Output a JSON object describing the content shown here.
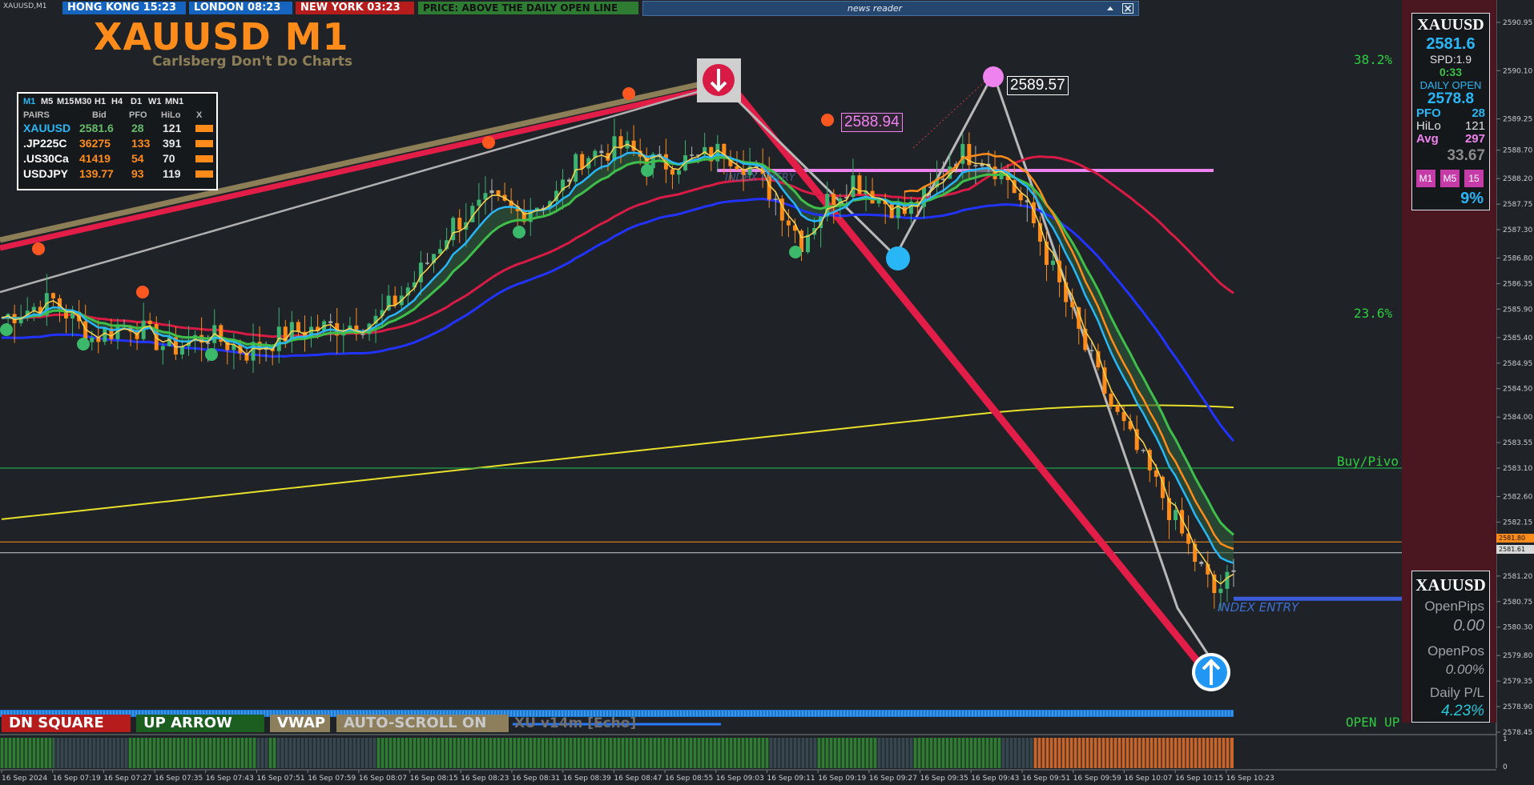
{
  "window": {
    "title": "XAUUSD,M1"
  },
  "topbar": {
    "items": [
      {
        "label": "HONG KONG 15:23",
        "bg": "#1565c0",
        "fg": "#ffffff"
      },
      {
        "label": "LONDON  08:23",
        "bg": "#1565c0",
        "fg": "#ffffff"
      },
      {
        "label": "NEW YORK  03:23",
        "bg": "#b71c1c",
        "fg": "#ffffff"
      },
      {
        "label": "PRICE: ABOVE THE DAILY OPEN LINE",
        "bg": "#2e7d32",
        "fg": "#111111"
      }
    ]
  },
  "news_reader": {
    "title": "news reader",
    "minimize_icon": "caret-up-icon",
    "close_icon": "close-icon"
  },
  "header": {
    "symbol": "XAUUSD M1",
    "subtitle": "Carlsberg Don't Do Charts"
  },
  "pairs_panel": {
    "timeframes": [
      "M1",
      "M5",
      "M15",
      "M30",
      "H1",
      "H4",
      "D1",
      "W1",
      "MN1"
    ],
    "headers": [
      "PAIRS",
      "Bid",
      "PFO",
      "HiLo",
      "X"
    ],
    "rows": [
      {
        "pair": "XAUUSD",
        "bid": "2581.6",
        "pfo": "28",
        "hilo": "121",
        "pair_color": "#29b6f6",
        "bid_color": "#66bb6a",
        "pfo_color": "#66bb6a"
      },
      {
        "pair": ".JP225C",
        "bid": "36275",
        "pfo": "133",
        "hilo": "391",
        "pair_color": "#ffffff",
        "bid_color": "#ff8c1a",
        "pfo_color": "#ff8c1a"
      },
      {
        "pair": ".US30Ca",
        "bid": "41419",
        "pfo": "54",
        "hilo": "70",
        "pair_color": "#ffffff",
        "bid_color": "#ff8c1a",
        "pfo_color": "#ff8c1a"
      },
      {
        "pair": "USDJPY",
        "bid": "139.77",
        "pfo": "93",
        "hilo": "119",
        "pair_color": "#ffffff",
        "bid_color": "#ff8c1a",
        "pfo_color": "#ff8c1a"
      }
    ]
  },
  "info_box": {
    "symbol": "XAUUSD",
    "price": "2581.6",
    "spread": "SPD:1.9",
    "timer": "0:33",
    "daily_open_label": "DAILY OPEN",
    "daily_open": "2578.8",
    "pfo_label": "PFO",
    "pfo": "28",
    "hilo_label": "HiLo",
    "hilo": "121",
    "avg_label": "Avg",
    "avg": "297",
    "ratio": "33.67",
    "tf_buttons": [
      "M1",
      "M5",
      "15"
    ],
    "percent": "9%"
  },
  "position_box": {
    "symbol": "XAUUSD",
    "open_pips_label": "OpenPips",
    "open_pips": "0.00",
    "open_pos_label": "OpenPos",
    "open_pos": "0.00%",
    "daily_pl_label": "Daily P/L",
    "daily_pl": "4.23%"
  },
  "chart_labels": {
    "fib_38": "38.2%",
    "fib_23": "23.6%",
    "buy_pivot": "Buy/Pivo",
    "open_up": "OPEN UP",
    "index_entry": "INDEX ENTRY",
    "index_entry_faded": "INDEX ENTRY",
    "price_high": "2589.57",
    "price_mid": "2588.94",
    "tag_orange": "2581.80",
    "tag_white": "2581.61"
  },
  "bottom_buttons": [
    {
      "label": "DN SQUARE",
      "bg": "#b71c1c",
      "fg": "#ffffff"
    },
    {
      "label": "UP ARROW",
      "bg": "#1b5e20",
      "fg": "#ffffff"
    },
    {
      "label": "VWAP",
      "bg": "#8d7f5c",
      "fg": "#ffffff"
    },
    {
      "label": "AUTO-SCROLL ON",
      "bg": "#8d7f5c",
      "fg": "#c9c9c9"
    }
  ],
  "indicator_name": "XU v14m [Echo]",
  "chart_data": {
    "type": "candlestick",
    "symbol": "XAUUSD",
    "timeframe": "M1",
    "y_ticks": [
      2590.95,
      2590.1,
      2589.25,
      2588.7,
      2588.2,
      2587.75,
      2587.3,
      2586.8,
      2586.35,
      2585.9,
      2585.4,
      2584.95,
      2584.5,
      2584.0,
      2583.55,
      2583.1,
      2582.6,
      2582.15,
      2581.2,
      2580.75,
      2580.3,
      2579.8,
      2579.35,
      2578.9,
      2578.45
    ],
    "y_tick_labels": [
      "2590.95",
      "2590.10",
      "2589.25",
      "2588.70",
      "2588.20",
      "2587.75",
      "2587.30",
      "2586.80",
      "2586.35",
      "2585.90",
      "2585.40",
      "2584.95",
      "2584.50",
      "2584.00",
      "2583.55",
      "2583.10",
      "2582.60",
      "2582.15",
      "2581.20",
      "2580.75",
      "2580.30",
      "2579.80",
      "2579.35",
      "2578.90",
      "2578.45"
    ],
    "x_ticks": [
      "16 Sep 2024",
      "16 Sep 07:19",
      "16 Sep 07:27",
      "16 Sep 07:35",
      "16 Sep 07:43",
      "16 Sep 07:51",
      "16 Sep 07:59",
      "16 Sep 08:07",
      "16 Sep 08:15",
      "16 Sep 08:23",
      "16 Sep 08:31",
      "16 Sep 08:39",
      "16 Sep 08:47",
      "16 Sep 08:55",
      "16 Sep 09:03",
      "16 Sep 09:11",
      "16 Sep 09:19",
      "16 Sep 09:27",
      "16 Sep 09:35",
      "16 Sep 09:43",
      "16 Sep 09:51",
      "16 Sep 09:59",
      "16 Sep 10:07",
      "16 Sep 10:15",
      "16 Sep 10:23"
    ],
    "price_path": [
      [
        0,
        2585.75
      ],
      [
        8,
        2586.05
      ],
      [
        14,
        2585.4
      ],
      [
        20,
        2585.65
      ],
      [
        26,
        2585.2
      ],
      [
        32,
        2585.45
      ],
      [
        38,
        2585.15
      ],
      [
        45,
        2585.5
      ],
      [
        52,
        2585.6
      ],
      [
        58,
        2585.7
      ],
      [
        64,
        2586.4
      ],
      [
        70,
        2587.4
      ],
      [
        76,
        2587.8
      ],
      [
        80,
        2587.6
      ],
      [
        86,
        2587.9
      ],
      [
        90,
        2588.6
      ],
      [
        96,
        2588.75
      ],
      [
        102,
        2588.45
      ],
      [
        108,
        2588.55
      ],
      [
        112,
        2588.7
      ],
      [
        116,
        2588.4
      ],
      [
        120,
        2587.85
      ],
      [
        124,
        2587.1
      ],
      [
        128,
        2587.8
      ],
      [
        132,
        2588.2
      ],
      [
        136,
        2587.85
      ],
      [
        140,
        2587.6
      ],
      [
        144,
        2587.95
      ],
      [
        148,
        2588.65
      ],
      [
        152,
        2588.6
      ],
      [
        156,
        2588.2
      ],
      [
        160,
        2587.4
      ],
      [
        164,
        2586.3
      ],
      [
        168,
        2585.2
      ],
      [
        172,
        2584.2
      ],
      [
        176,
        2583.4
      ],
      [
        180,
        2582.6
      ],
      [
        184,
        2581.7
      ],
      [
        188,
        2580.9
      ],
      [
        191,
        2581.2
      ]
    ],
    "pivot_line": 2583.1,
    "daily_open_line": 2581.8,
    "current_price": 2581.61,
    "index_entry": 2580.8,
    "fib_levels": [
      {
        "label": "38.2%",
        "value": 2590.1
      },
      {
        "label": "23.6%",
        "value": 2585.4
      }
    ],
    "colors": {
      "bull": "#3cb371",
      "bear": "#ff8c1a",
      "neutral": "#b0b0b0",
      "ema_fast": "#ffd54f",
      "ema_mid": "#29b6f6",
      "ema_slow": "#3fbf4a",
      "ma_blue": "#2233ff",
      "ma_red": "#d81b45",
      "ma_yellow": "#e8e02a",
      "pink_line": "#ee82ee",
      "trend_red": "#e11d48"
    }
  }
}
